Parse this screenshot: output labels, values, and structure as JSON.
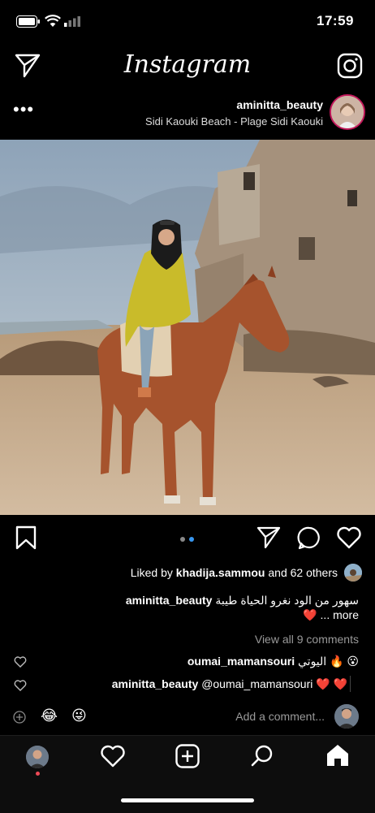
{
  "status_bar": {
    "time": "17:59"
  },
  "app": {
    "title": "Instagram"
  },
  "post": {
    "username": "aminitta_beauty",
    "location": "Sidi Kaouki Beach - Plage Sidi Kaouki",
    "more_icon": "more-icon",
    "carousel": {
      "count": 2,
      "active": 1
    },
    "likes": {
      "prefix": "Liked by",
      "user": "khadija.sammou",
      "suffix": "and 62 others"
    },
    "caption": {
      "user": "aminitta_beauty",
      "text_line1": "ﺳﻬﻮﺭ ﻣﻦ ﺍﻟﻮﺩ ﻧﻐﺮﻭ ﺍﻟﺤﻴﺎﺓ ﻃﻴﺒﺔ",
      "text_line2": "❤️ ... more"
    },
    "view_comments": "View all 9 comments",
    "comments": [
      {
        "user": "oumai_mamansouri",
        "text": "ﺍﻟﻴﻮﺗﻲ 🔥 😮"
      },
      {
        "user": "aminitta_beauty",
        "text": "@oumai_mamansouri ❤️ ❤️"
      }
    ],
    "add_comment": "Add a comment...",
    "emoji_a": "😂",
    "emoji_b": "😜"
  },
  "nav": {
    "items": [
      "profile-avatar",
      "activity-heart-icon",
      "new-post-icon",
      "search-icon",
      "home-icon"
    ]
  }
}
